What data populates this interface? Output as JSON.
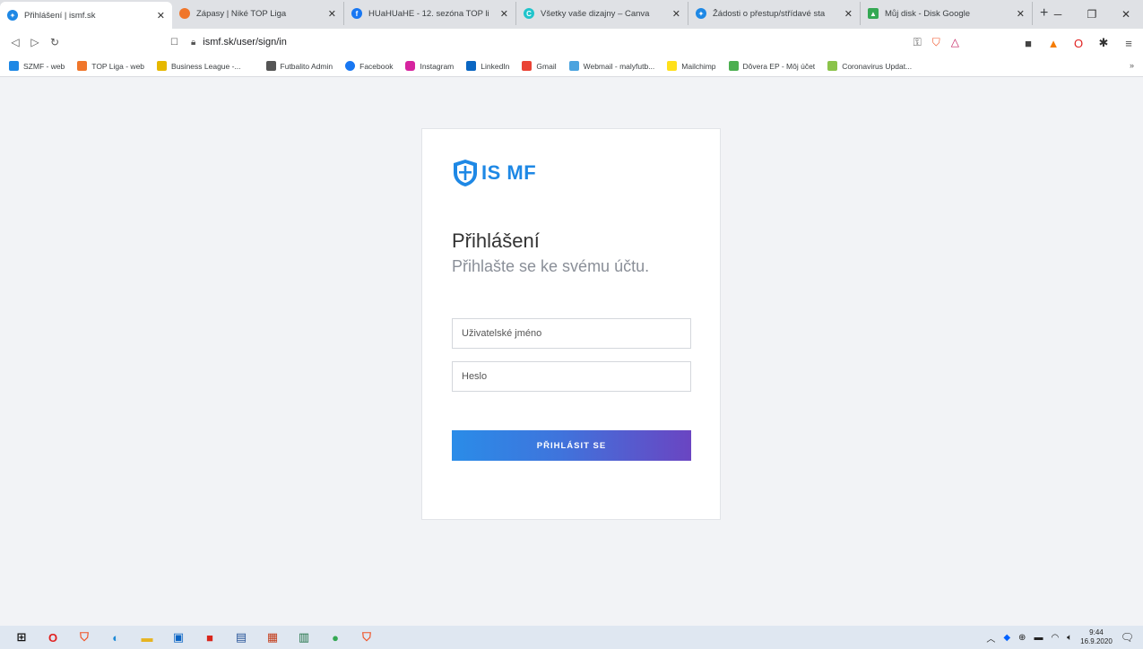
{
  "browser": {
    "tabs": [
      {
        "title": "Přihlášení | ismf.sk",
        "icon": "ismf-icon",
        "color": "#1e88e5"
      },
      {
        "title": "Zápasy | Niké TOP Liga",
        "icon": "brave-icon",
        "color": "#f0762b"
      },
      {
        "title": "HUaHUaHE - 12. sezóna TOP li",
        "icon": "facebook-icon",
        "color": "#1877f2"
      },
      {
        "title": "Všetky vaše dizajny – Canva",
        "icon": "canva-icon",
        "color": "#20c4cb"
      },
      {
        "title": "Žádosti o přestup/střídavé sta",
        "icon": "ismf-icon",
        "color": "#1e88e5"
      },
      {
        "title": "Můj disk - Disk Google",
        "icon": "drive-icon",
        "color": "#34a853"
      }
    ],
    "new_tab_symbol": "+",
    "url": "ismf.sk/user/sign/in",
    "bookmarks": [
      {
        "label": "SZMF - web",
        "color": "#1e88e5"
      },
      {
        "label": "TOP Liga - web",
        "color": "#f0762b"
      },
      {
        "label": "Business League -...",
        "color": "#e6b800"
      },
      {
        "label": "Futbalito Admin",
        "color": "#555555"
      },
      {
        "label": "Facebook",
        "color": "#1877f2"
      },
      {
        "label": "Instagram",
        "color": "#d6249f"
      },
      {
        "label": "LinkedIn",
        "color": "#0a66c2"
      },
      {
        "label": "Gmail",
        "color": "#ea4335"
      },
      {
        "label": "Webmail - malyfutb...",
        "color": "#4aa3df"
      },
      {
        "label": "Mailchimp",
        "color": "#ffe01b"
      },
      {
        "label": "Dôvera EP - Môj účet",
        "color": "#4caf50"
      },
      {
        "label": "Coronavirus Updat...",
        "color": "#8bc34a"
      }
    ]
  },
  "login": {
    "brand": "IS MF",
    "heading": "Přihlášení",
    "subheading": "Přihlašte se ke svému účtu.",
    "username_placeholder": "Uživatelské jméno",
    "password_placeholder": "Heslo",
    "submit_label": "PŘIHLÁSIT SE",
    "accent_color": "#1e88e5"
  },
  "taskbar": {
    "time": "9:44",
    "date": "16.9.2020"
  }
}
